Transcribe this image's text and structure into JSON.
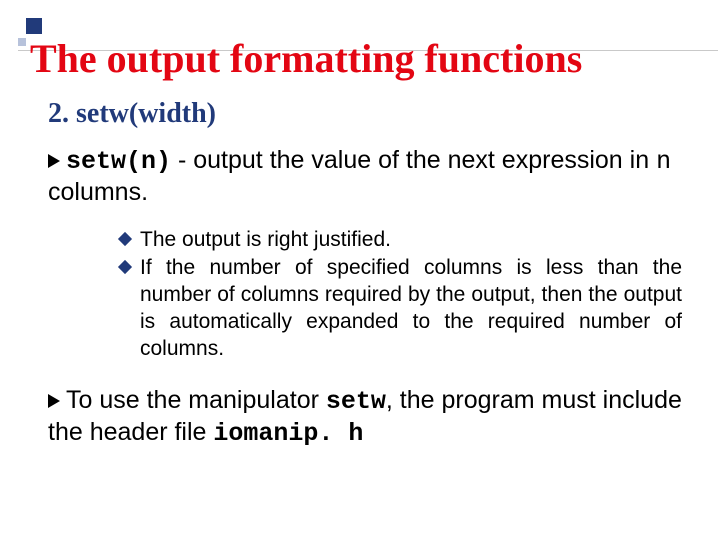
{
  "slide": {
    "title": "The output formatting functions",
    "subhead": "2. setw(width)",
    "p1_code": "setw(n)",
    "p1_mid": " - output the value of the next expression in ",
    "p1_code2": "n",
    "p1_end": " columns.",
    "sub": {
      "a": "The output is right justified.",
      "b": "If the number of specified columns is less than the number of columns required by the output, then the output is automatically expanded to the required number of columns."
    },
    "p2_a": "To use the manipulator ",
    "p2_code1": "setw",
    "p2_b": ", the program must include the header file ",
    "p2_code2": "iomanip. h"
  }
}
